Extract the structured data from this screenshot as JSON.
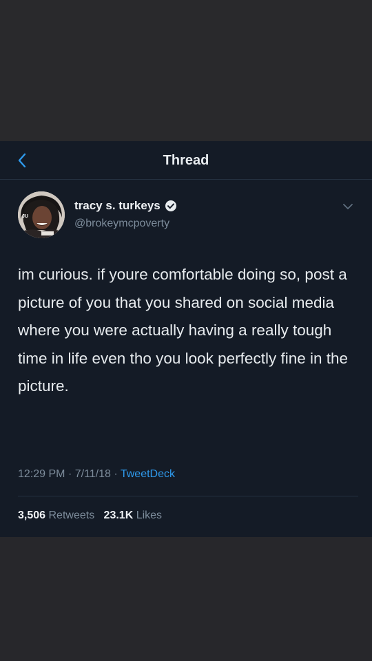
{
  "header": {
    "title": "Thread"
  },
  "author": {
    "name": "tracy s. turkeys",
    "handle": "@brokeymcpoverty"
  },
  "tweet": {
    "text": "im curious. if youre comfortable doing so, post a picture of you that you shared on social media where you were actually having a really tough time in life even tho you look perfectly fine in the picture.",
    "time": "12:29 PM",
    "date": "7/11/18",
    "source": "TweetDeck"
  },
  "stats": {
    "retweets_count": "3,506",
    "retweets_label": "Retweets",
    "likes_count": "23.1K",
    "likes_label": "Likes"
  },
  "colors": {
    "background": "#141b26",
    "accent": "#2f9bee",
    "text": "#e7ebee",
    "muted": "#7d8c9b"
  },
  "icons": {
    "back": "chevron-left-icon",
    "verified": "verified-badge-icon",
    "more": "chevron-down-icon"
  }
}
